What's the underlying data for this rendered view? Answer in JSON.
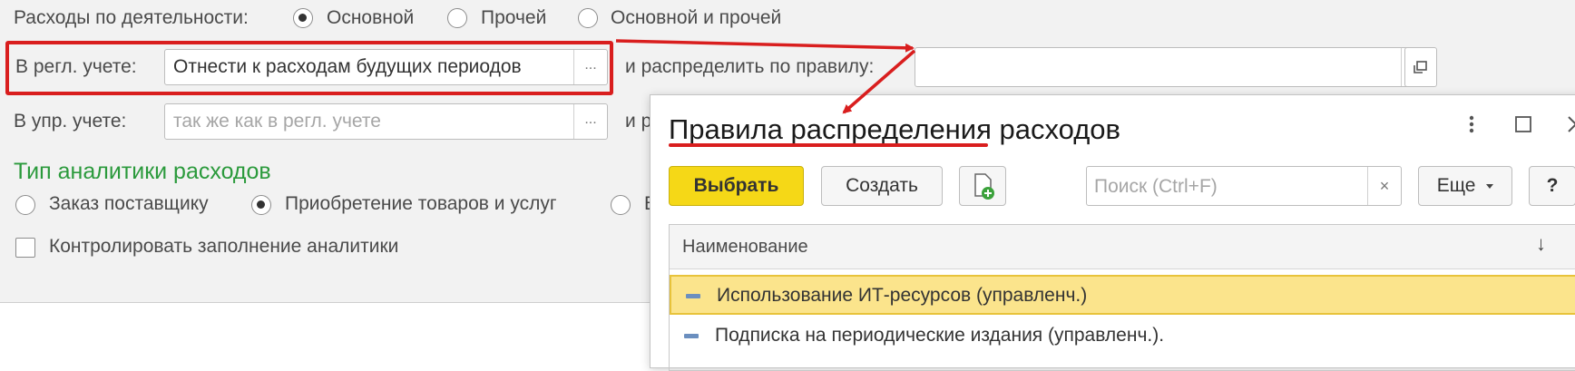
{
  "form": {
    "activity_label": "Расходы по деятельности:",
    "activity_options": [
      "Основной",
      "Прочей",
      "Основной и прочей"
    ],
    "activity_selected": "Основной",
    "regl_label": "В регл. учете:",
    "regl_value": "Отнести к расходам будущих периодов",
    "distribute_label": "и распределить по правилу:",
    "distribute_value": "",
    "upr_label": "В упр. учете:",
    "upr_placeholder": "так же как в регл. учете",
    "upr_partial_label": "и р",
    "dots": "...",
    "analytics_title": "Тип аналитики расходов",
    "analytics_options": [
      "Заказ поставщику",
      "Приобретение товаров и услуг",
      "В"
    ],
    "analytics_selected": "Приобретение товаров и услуг",
    "control_label": "Контролировать заполнение аналитики",
    "control_checked": false
  },
  "dialog": {
    "title": "Правила распределения расходов",
    "more_icon": "vertical-dots-icon",
    "maximize_icon": "maximize-icon",
    "close_icon": "close-icon",
    "select_button": "Выбрать",
    "create_button": "Создать",
    "create_copy_icon": "add-document-icon",
    "search_placeholder": "Поиск (Ctrl+F)",
    "search_clear": "×",
    "more_button": "Еще",
    "help_button": "?",
    "column_header": "Наименование",
    "sort_indicator": "↓",
    "rows": [
      "Использование ИТ-ресурсов (управленч.)",
      "Подписка на периодические издания (управленч.)."
    ],
    "selected_row": 0
  },
  "colors": {
    "annotation_red": "#d91e1e",
    "section_green": "#2b9a3c",
    "primary_yellow": "#f5d817",
    "selected_row": "#fbe48c"
  }
}
